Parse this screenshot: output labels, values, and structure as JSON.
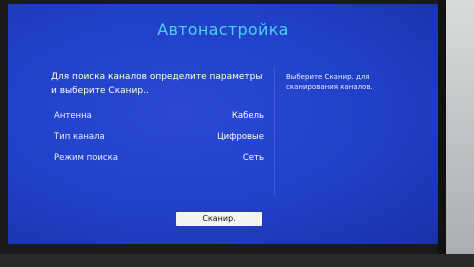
{
  "screen": {
    "title": "Автонастройка",
    "instruction": "Для поиска каналов определите параметры и выберите Сканир..",
    "hint": "Выберите Сканир. для сканирования каналов.",
    "settings": [
      {
        "label": "Антенна",
        "value": "Кабель"
      },
      {
        "label": "Тип канала",
        "value": "Цифровые"
      },
      {
        "label": "Режим поиска",
        "value": "Сеть"
      }
    ],
    "scan_button": "Сканир."
  }
}
